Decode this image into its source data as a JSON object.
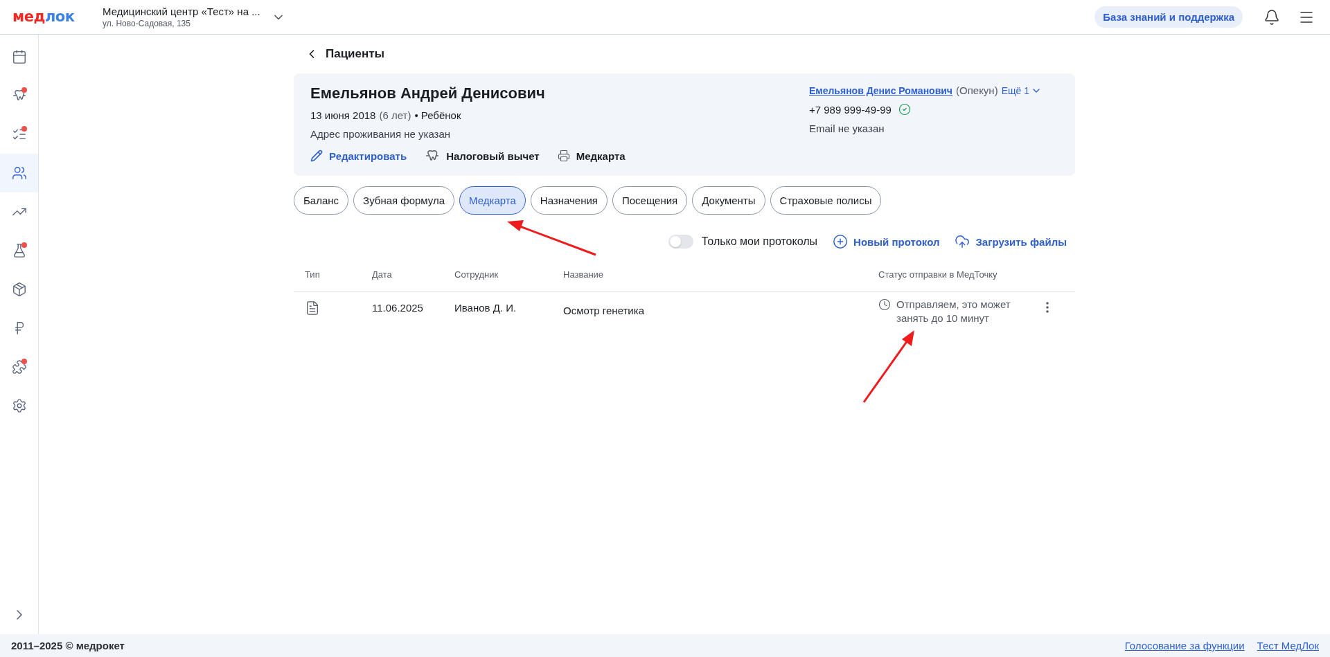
{
  "header": {
    "logo": {
      "accent": "мед",
      "rest": "лок"
    },
    "clinic": {
      "name": "Медицинский центр «Тест» на ...",
      "address": "ул. Ново-Садовая, 135"
    },
    "help_button": "База знаний и поддержка"
  },
  "sidebar": {
    "items": [
      {
        "selected": false,
        "badge": false
      },
      {
        "selected": false,
        "badge": true
      },
      {
        "selected": false,
        "badge": true
      },
      {
        "selected": true,
        "badge": false
      },
      {
        "selected": false,
        "badge": false
      },
      {
        "selected": false,
        "badge": true
      },
      {
        "selected": false,
        "badge": false
      },
      {
        "selected": false,
        "badge": false
      },
      {
        "selected": false,
        "badge": true
      },
      {
        "selected": false,
        "badge": false
      }
    ]
  },
  "breadcrumb": "Пациенты",
  "patient": {
    "name": "Емельянов Андрей Денисович",
    "birth": "13 июня 2018",
    "age": "(6 лет)",
    "category": "• Ребёнок",
    "address": "Адрес проживания не указан",
    "actions": [
      {
        "label": "Редактировать",
        "kind": "edit"
      },
      {
        "label": "Налоговый вычет",
        "kind": "tax"
      },
      {
        "label": "Медкарта",
        "kind": "print"
      }
    ],
    "guardian": {
      "name": "Емельянов Денис Романович",
      "role": "(Опекун)",
      "more": "Ещё 1",
      "phone": "+7 989 999-49-99",
      "phone_verified": true,
      "email": "Email не указан"
    }
  },
  "tabs": [
    {
      "label": "Баланс",
      "selected": false
    },
    {
      "label": "Зубная формула",
      "selected": false
    },
    {
      "label": "Медкарта",
      "selected": true
    },
    {
      "label": "Назначения",
      "selected": false
    },
    {
      "label": "Посещения",
      "selected": false
    },
    {
      "label": "Документы",
      "selected": false
    },
    {
      "label": "Страховые полисы",
      "selected": false
    }
  ],
  "toolbar": {
    "toggle": {
      "label": "Только мои протоколы",
      "on": false
    },
    "new_button": "Новый протокол",
    "upload_button": "Загрузить файлы"
  },
  "table": {
    "columns": [
      "Тип",
      "Дата",
      "Сотрудник",
      "Название",
      "Статус отправки в МедТочку"
    ],
    "rows": [
      {
        "date": "11.06.2025",
        "staff": "Иванов Д. И.",
        "title": "Осмотр генетика",
        "status": "Отправляем, это может занять до 10 минут"
      }
    ]
  },
  "footer": {
    "copyright": "2011–2025 © медрокет",
    "links": [
      "Голосование за функции",
      "Тест МедЛок"
    ]
  }
}
